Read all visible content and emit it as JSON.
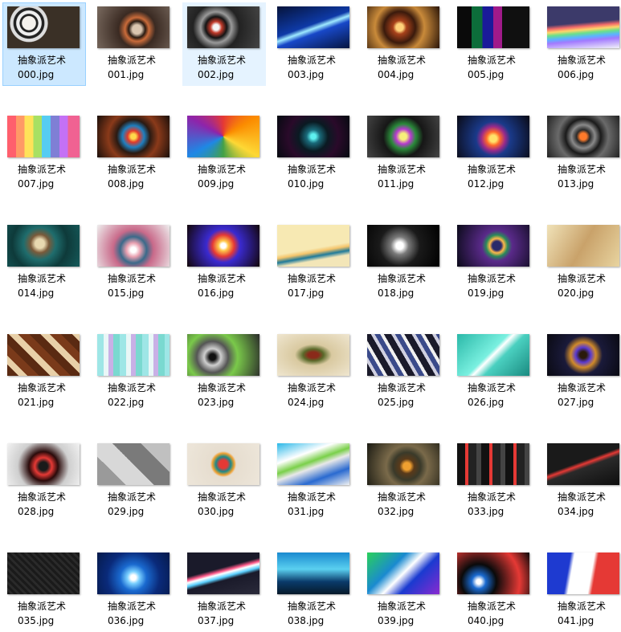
{
  "files": [
    {
      "name": "抽象派艺术",
      "ext": "000.jpg",
      "icon": "zebra-image-icon",
      "selected": true,
      "bg": "radial-gradient(circle at 30% 40%, #f4f1ec 0 12%, #222 13% 16%, #eee 17% 22%, #222 23% 27%, #ddd 28% 33%, #3a3026 34% 100%)"
    },
    {
      "name": "抽象派艺术",
      "ext": "001.jpg",
      "icon": "knot-image-icon",
      "bg": "radial-gradient(circle at 55% 55%, #d9c5b0 0 10%, #2a1b12 18%, #c96b3a 26%, #3a2a22 40%, #7a6b60 100%)"
    },
    {
      "name": "抽象派艺术",
      "ext": "002.jpg",
      "icon": "chain-image-icon",
      "hover": true,
      "bg": "radial-gradient(circle at 40% 50%, #f5f5f5 0 6%, #c23a2a 12%, #141414 22%, #9a9a9a 32%, #222 48%, #444 100%)"
    },
    {
      "name": "抽象派艺术",
      "ext": "003.jpg",
      "icon": "lightning-image-icon",
      "bg": "linear-gradient(160deg, #06133a 0%, #0e3aa8 45%, #9ee9ff 52%, #1848c8 60%, #061540 100%)"
    },
    {
      "name": "抽象派艺术",
      "ext": "004.jpg",
      "icon": "orb-image-icon",
      "bg": "radial-gradient(circle at 45% 50%, #ffd27a 0 8%, #a8421b 15%, #3a1a0c 35%, #c98a3a 55%, #2a1408 100%)"
    },
    {
      "name": "抽象派艺术",
      "ext": "005.jpg",
      "icon": "cubes-image-icon",
      "bg": "linear-gradient(90deg, #0a0a0a 0 20%, #0c6d3a 20% 35%, #1a1a9a 35% 50%, #a01a8a 50% 62%, #101010 62% 100%)"
    },
    {
      "name": "抽象派艺术",
      "ext": "006.jpg",
      "icon": "rainbow-stripes-image-icon",
      "bg": "linear-gradient(175deg, #3c3a6a 0 40%, #f26a6a 48%, #ffd56a 55%, #6ae08a 62%, #5ab4ff 70%, #a27aff 78%, #f0f0f8 100%)"
    },
    {
      "name": "抽象派艺术",
      "ext": "007.jpg",
      "icon": "color-bars-image-icon",
      "bg": "linear-gradient(90deg, #ff5f6d 0 12%, #ff9966 12% 24%, #ffe259 24% 36%, #a8e063 36% 48%, #56ccf2 48% 60%, #7f7fd5 60% 72%, #c471f5 72% 84%, #f06292 84% 100%)"
    },
    {
      "name": "抽象派艺术",
      "ext": "008.jpg",
      "icon": "flower-fractal-image-icon",
      "bg": "radial-gradient(circle at 50% 50%, #ffd84a 0 6%, #e23a2a 14%, #1f7fbf 26%, #2a1a12 40%, #8a3a1a 60%, #1a0f0a 100%)"
    },
    {
      "name": "抽象派艺术",
      "ext": "009.jpg",
      "icon": "color-rays-image-icon",
      "bg": "conic-gradient(from 0deg at 50% 50%, #e53935, #fb8c00, #fdd835, #43a047, #1e88e5, #8e24aa, #e53935)"
    },
    {
      "name": "抽象派艺术",
      "ext": "010.jpg",
      "icon": "cyan-swirl-image-icon",
      "bg": "radial-gradient(circle at 50% 50%, #5ef0f0 0 6%, #1a6a7a 16%, #0a1a22 35%, #2a0a2a 60%, #050a10 100%)"
    },
    {
      "name": "抽象派艺术",
      "ext": "011.jpg",
      "icon": "star-fractal-image-icon",
      "bg": "radial-gradient(circle at 50% 50%, #f7f07a 0 8%, #b63ad0 18%, #2a8a3a 30%, #161616 48%, #444 100%)"
    },
    {
      "name": "抽象派艺术",
      "ext": "012.jpg",
      "icon": "fire-fractal-image-icon",
      "bg": "radial-gradient(circle at 50% 55%, #ffe36a 0 8%, #ff6a2a 16%, #9a2a8a 28%, #1a3a8a 40%, #0a0a14 100%)"
    },
    {
      "name": "抽象派艺术",
      "ext": "013.jpg",
      "icon": "gear-fractal-image-icon",
      "bg": "radial-gradient(circle at 50% 50%, #ff7a2a 0 8%, #2a2a2a 16%, #8a8a8a 28%, #1a1a1a 42%, #6a6a6a 60%, #222 100%)"
    },
    {
      "name": "抽象派艺术",
      "ext": "014.jpg",
      "icon": "teal-fractal-image-icon",
      "bg": "radial-gradient(circle at 45% 45%, #e8d9b0 0 10%, #7a5a3a 20%, #1f6d6d 35%, #0e3a3a 60%, #155a5a 100%)"
    },
    {
      "name": "抽象派艺术",
      "ext": "015.jpg",
      "icon": "feather-image-icon",
      "bg": "radial-gradient(circle at 50% 60%, #ffffff 0 6%, #e9a0b0 16%, #3a6a8a 30%, #c96a8a 46%, #eee 100%)"
    },
    {
      "name": "抽象派艺术",
      "ext": "016.jpg",
      "icon": "red-glow-image-icon",
      "bg": "radial-gradient(circle at 50% 50%, #ffffff 0 6%, #ffc84a 12%, #e53935 26%, #3a2ad0 40%, #120608 100%)"
    },
    {
      "name": "抽象派艺术",
      "ext": "017.jpg",
      "icon": "wave-image-icon",
      "bg": "linear-gradient(170deg, #f7e9b3 0 55%, #f4c46a 62%, #1e7a9a 70%, #f3e6b8 78%, #f3e6b8 100%)"
    },
    {
      "name": "抽象派艺术",
      "ext": "018.jpg",
      "icon": "light-text-image-icon",
      "bg": "radial-gradient(circle at 45% 50%, #ffffff 0 8%, #7a7a7a 20%, #1a1a1a 45%, #000 100%)"
    },
    {
      "name": "抽象派艺术",
      "ext": "019.jpg",
      "icon": "ring-image-icon",
      "bg": "radial-gradient(circle at 55% 50%, #2a2a6a 0 10%, #ffb84a 16%, #2a8a5a 24%, #5a2a8a 34%, #0a0a18 100%)"
    },
    {
      "name": "抽象派艺术",
      "ext": "020.jpg",
      "icon": "ornament-image-icon",
      "bg": "linear-gradient(120deg, #f0e2b8 0%, #c9a26a 50%, #e8d4a0 100%)"
    },
    {
      "name": "抽象派艺术",
      "ext": "021.jpg",
      "icon": "links-image-icon",
      "bg": "repeating-linear-gradient(45deg, #5a2a12 0 10px, #e8d0a8 10px 18px, #7a3a1a 18px 28px)"
    },
    {
      "name": "抽象派艺术",
      "ext": "022.jpg",
      "icon": "pastel-stripes-image-icon",
      "bg": "repeating-linear-gradient(90deg, #9ee6e6 0 8px, #e9f7f7 8px 14px, #c9b0e6 14px 20px, #7ad9d0 20px 28px)"
    },
    {
      "name": "抽象派艺术",
      "ext": "023.jpg",
      "icon": "vortex-image-icon",
      "bg": "radial-gradient(circle at 35% 55%, #111 0 6%, #cfcfcf 16%, #555 30%, #7ac94a 48%, #2a2a2a 100%)"
    },
    {
      "name": "抽象派艺术",
      "ext": "024.jpg",
      "icon": "symmetry-image-icon",
      "bg": "radial-gradient(ellipse at 50% 50%, #8a2a1a 0 10%, #5a6a2a 20%, #d9c9a0 36%, #efe6d0 100%)"
    },
    {
      "name": "抽象派艺术",
      "ext": "025.jpg",
      "icon": "diagonal-stripes-image-icon",
      "bg": "repeating-linear-gradient(60deg, #1a1a2a 0 8px, #d0d0e0 8px 12px, #3a4a8a 12px 18px, #f0f0f0 18px 22px)"
    },
    {
      "name": "抽象派艺术",
      "ext": "026.jpg",
      "icon": "aqua-image-icon",
      "bg": "linear-gradient(135deg, #2ab8a8 0%, #7af0e0 45%, #ffffff 50%, #4ad0c0 60%, #1a8a80 100%)"
    },
    {
      "name": "抽象派艺术",
      "ext": "027.jpg",
      "icon": "blue-knot-image-icon",
      "bg": "radial-gradient(circle at 50% 50%, #2a1a0a 0 8%, #5a3ad0 18%, #d08a2a 30%, #1a1a3a 46%, #0a0a12 100%)"
    },
    {
      "name": "抽象派艺术",
      "ext": "028.jpg",
      "icon": "red-spikes-image-icon",
      "bg": "radial-gradient(circle at 50% 55%, #1a1a1a 0 10%, #e53935 20%, #2a0a0a 34%, #cfcfcf 60%, #f2f2f2 100%)"
    },
    {
      "name": "抽象派艺术",
      "ext": "029.jpg",
      "icon": "gray-squares-image-icon",
      "bg": "linear-gradient(45deg, #9a9a9a 25%, #d8d8d8 25% 50%, #7a7a7a 50% 75%, #c0c0c0 75%)"
    },
    {
      "name": "抽象派艺术",
      "ext": "030.jpg",
      "icon": "circle-art-image-icon",
      "bg": "radial-gradient(circle at 50% 50%, #e53935 0 10%, #1a8a8a 18%, #f0a030 26%, #e6ddcf 31%, #ede6da 100%)"
    },
    {
      "name": "抽象派艺术",
      "ext": "031.jpg",
      "icon": "ribbons-image-icon",
      "bg": "linear-gradient(160deg, #2ab8e8 0%, #ffffff 30%, #7ad04a 45%, #e8e8e8 55%, #2a6ad0 75%, #f2f2f2 100%)"
    },
    {
      "name": "抽象派艺术",
      "ext": "032.jpg",
      "icon": "eye-image-icon",
      "bg": "radial-gradient(circle at 55% 55%, #f0a030 0 8%, #5a3a1a 16%, #3a3a2a 30%, #7a6a4a 45%, #1a1a12 100%)"
    },
    {
      "name": "抽象派艺术",
      "ext": "033.jpg",
      "icon": "red-blocks-image-icon",
      "bg": "repeating-linear-gradient(90deg, #111 0 10px, #e53935 10px 14px, #222 14px 24px, #444 24px 30px)"
    },
    {
      "name": "抽象派艺术",
      "ext": "034.jpg",
      "icon": "red-curve-image-icon",
      "bg": "linear-gradient(160deg, #1a1a1a 0 45%, #e53935 50%, #2a2a2a 56%, #0e0e0e 100%)"
    },
    {
      "name": "抽象派艺术",
      "ext": "035.jpg",
      "icon": "carbon-image-icon",
      "bg": "repeating-linear-gradient(45deg, #1a1a1a 0 3px, #2a2a2a 3px 6px)"
    },
    {
      "name": "抽象派艺术",
      "ext": "036.jpg",
      "icon": "blue-burst-image-icon",
      "bg": "radial-gradient(circle at 50% 60%, #ffffff 0 6%, #7ad0ff 14%, #1a6ad0 30%, #0a2a7a 60%, #061a4a 100%)"
    },
    {
      "name": "抽象派艺术",
      "ext": "037.jpg",
      "icon": "neon-curves-image-icon",
      "bg": "linear-gradient(165deg, #1a1a2a 0 40%, #ff5a8a 46%, #ffffff 50%, #5ad0ff 56%, #1a1a2a 62%, #2a2a3a 100%)"
    },
    {
      "name": "抽象派艺术",
      "ext": "038.jpg",
      "icon": "city-skyline-image-icon",
      "bg": "linear-gradient(180deg, #1a8ad0 0%, #5ad0f0 40%, #0a3a6a 70%, #061a2a 100%)"
    },
    {
      "name": "抽象派艺术",
      "ext": "039.jpg",
      "icon": "spectrum-image-icon",
      "bg": "linear-gradient(135deg, #2ad05a 0%, #1a8ad0 35%, #ffffff 50%, #1a3ad0 65%, #8a2ad0 100%)"
    },
    {
      "name": "抽象派艺术",
      "ext": "040.jpg",
      "icon": "dark-glow-image-icon",
      "bg": "radial-gradient(circle at 30% 70%, #ffffff 0 4%, #1a6ad0 12%, #0a0a0a 30%, #e53935 70%, #0a0a0a 100%)"
    },
    {
      "name": "抽象派艺术",
      "ext": "041.jpg",
      "icon": "flag-wave-image-icon",
      "bg": "linear-gradient(100deg, #1e3ad0 0 30%, #ffffff 35% 60%, #e53935 65% 100%)"
    }
  ]
}
